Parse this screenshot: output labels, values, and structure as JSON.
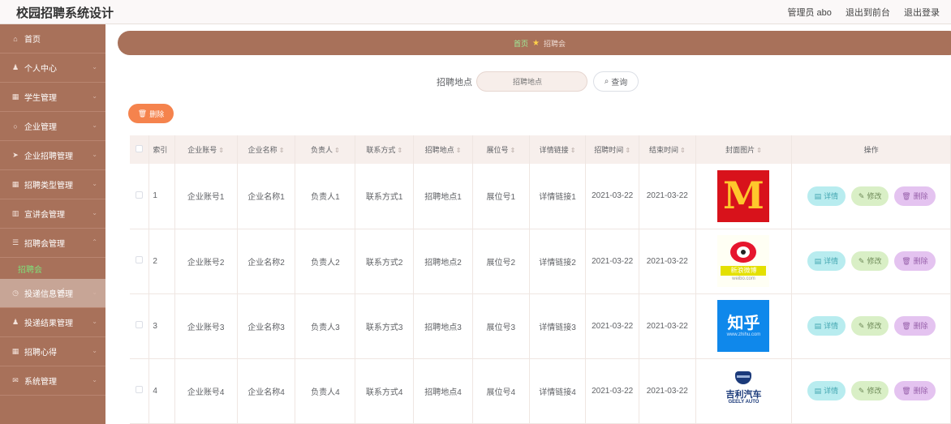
{
  "header": {
    "title": "校园招聘系统设计",
    "links": [
      "管理员 abo",
      "退出到前台",
      "退出登录"
    ]
  },
  "sidebar": {
    "items": [
      {
        "label": "首页",
        "icon": "home-icon",
        "glyph": "⌂"
      },
      {
        "label": "个人中心",
        "icon": "person-icon",
        "glyph": "♟"
      },
      {
        "label": "学生管理",
        "icon": "grid-icon",
        "glyph": "▦"
      },
      {
        "label": "企业管理",
        "icon": "circle-icon",
        "glyph": "○"
      },
      {
        "label": "企业招聘管理",
        "icon": "send-icon",
        "glyph": "➤"
      },
      {
        "label": "招聘类型管理",
        "icon": "grid-icon",
        "glyph": "▦"
      },
      {
        "label": "宣讲会管理",
        "icon": "chart-icon",
        "glyph": "▥"
      },
      {
        "label": "招聘会管理",
        "icon": "list-icon",
        "glyph": "☰"
      },
      {
        "label": "投递信息管理",
        "icon": "clock-icon",
        "glyph": "◷"
      },
      {
        "label": "投递结果管理",
        "icon": "person-icon",
        "glyph": "♟"
      },
      {
        "label": "招聘心得",
        "icon": "grid-icon",
        "glyph": "▦"
      },
      {
        "label": "系统管理",
        "icon": "mail-icon",
        "glyph": "✉"
      }
    ],
    "submenu_active": "招聘会"
  },
  "breadcrumb": {
    "home": "首页",
    "current": "招聘会"
  },
  "search": {
    "label": "招聘地点",
    "placeholder": "招聘地点",
    "button_label": "查询"
  },
  "toolbar": {
    "delete_label": "删除"
  },
  "table": {
    "headers": [
      "索引",
      "企业账号",
      "企业名称",
      "负责人",
      "联系方式",
      "招聘地点",
      "展位号",
      "详情链接",
      "招聘时间",
      "结束时间",
      "封面图片",
      "操作"
    ],
    "rows": [
      {
        "index": "1",
        "account": "企业账号1",
        "name": "企业名称1",
        "manager": "负责人1",
        "contact": "联系方式1",
        "location": "招聘地点1",
        "booth": "展位号1",
        "link": "详情链接1",
        "start": "2021-03-22",
        "end": "2021-03-22",
        "logo": "mcdonalds-logo"
      },
      {
        "index": "2",
        "account": "企业账号2",
        "name": "企业名称2",
        "manager": "负责人2",
        "contact": "联系方式2",
        "location": "招聘地点2",
        "booth": "展位号2",
        "link": "详情链接2",
        "start": "2021-03-22",
        "end": "2021-03-22",
        "logo": "weibo-logo"
      },
      {
        "index": "3",
        "account": "企业账号3",
        "name": "企业名称3",
        "manager": "负责人3",
        "contact": "联系方式3",
        "location": "招聘地点3",
        "booth": "展位号3",
        "link": "详情链接3",
        "start": "2021-03-22",
        "end": "2021-03-22",
        "logo": "zhihu-logo"
      },
      {
        "index": "4",
        "account": "企业账号4",
        "name": "企业名称4",
        "manager": "负责人4",
        "contact": "联系方式4",
        "location": "招聘地点4",
        "booth": "展位号4",
        "link": "详情链接4",
        "start": "2021-03-22",
        "end": "2021-03-22",
        "logo": "geely-logo"
      }
    ],
    "actions": {
      "detail": "详情",
      "edit": "修改",
      "delete": "删除"
    }
  },
  "logo_text": {
    "mcdonalds": "M",
    "weibo": "新浪微博",
    "weibo_sub": "weibo.com",
    "zhihu": "知乎",
    "zhihu_sub": "www.zhihu.com",
    "geely": "吉利汽车",
    "geely_sub": "GEELY AUTO"
  },
  "colors": {
    "sidebar": "#a8715a",
    "accent_orange": "#f5834d",
    "submenu_active": "#7fe07a"
  }
}
